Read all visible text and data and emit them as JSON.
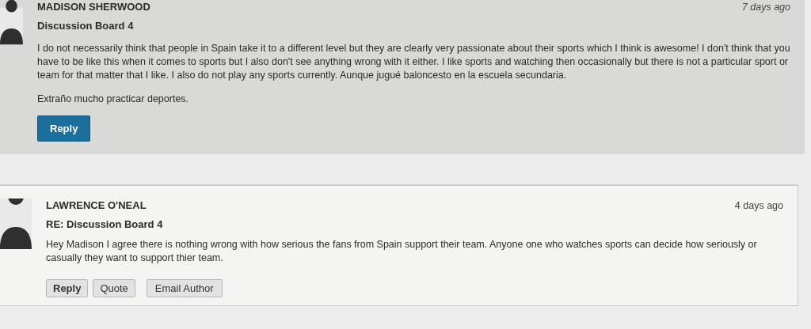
{
  "posts": [
    {
      "author": "MADISON SHERWOOD",
      "time": "7 days ago",
      "subject": "Discussion Board 4",
      "highlighted": true,
      "paragraphs": [
        "I do not necessarily think that people in Spain take it to a different level but they are clearly very passionate about their sports which I think is awesome! I don't think that you have to be like this when it comes to sports but I also don't see anything wrong with it either. I like sports and watching then occasionally but there is not a particular sport or team for that matter that I like. I also do not play any sports currently. Aunque jugué baloncesto en la escuela secundaria.",
        "Extraño mucho practicar deportes."
      ],
      "buttons": [
        {
          "label": "Reply",
          "kind": "primary"
        }
      ]
    },
    {
      "author": "LAWRENCE O'NEAL",
      "time": "4 days ago",
      "subject": "RE: Discussion Board 4",
      "highlighted": false,
      "paragraphs": [
        "Hey Madison I agree there is nothing wrong with how serious the fans from Spain support their team. Anyone one who watches sports can decide how seriously or casually they want to support thier team."
      ],
      "buttons": [
        {
          "label": "Reply",
          "kind": "strong"
        },
        {
          "label": "Quote",
          "kind": "plain"
        },
        {
          "label": "Email Author",
          "kind": "plain"
        }
      ]
    }
  ]
}
